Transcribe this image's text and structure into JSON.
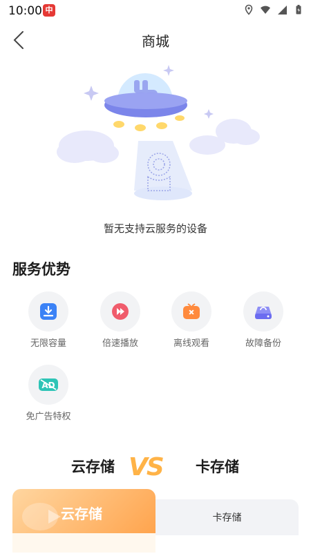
{
  "status_bar": {
    "time": "10:00",
    "app_badge": "中"
  },
  "nav": {
    "title": "商城"
  },
  "empty_state": {
    "text": "暂无支持云服务的设备"
  },
  "services": {
    "title": "服务优势",
    "items": [
      {
        "label": "无限容量",
        "icon": "download-icon",
        "color": "#3b82f6"
      },
      {
        "label": "倍速播放",
        "icon": "fast-forward-icon",
        "color": "#f05c6c"
      },
      {
        "label": "离线观看",
        "icon": "offline-tv-icon",
        "color": "#ff8a3d"
      },
      {
        "label": "故障备份",
        "icon": "backup-drive-icon",
        "color": "#6b6cf0"
      },
      {
        "label": "免广告特权",
        "icon": "ad-free-icon",
        "color": "#2ec4b6"
      }
    ]
  },
  "compare": {
    "left": "云存储",
    "vs": "VS",
    "right": "卡存储",
    "card_left_label": "云存储",
    "card_right_label": "卡存储"
  }
}
